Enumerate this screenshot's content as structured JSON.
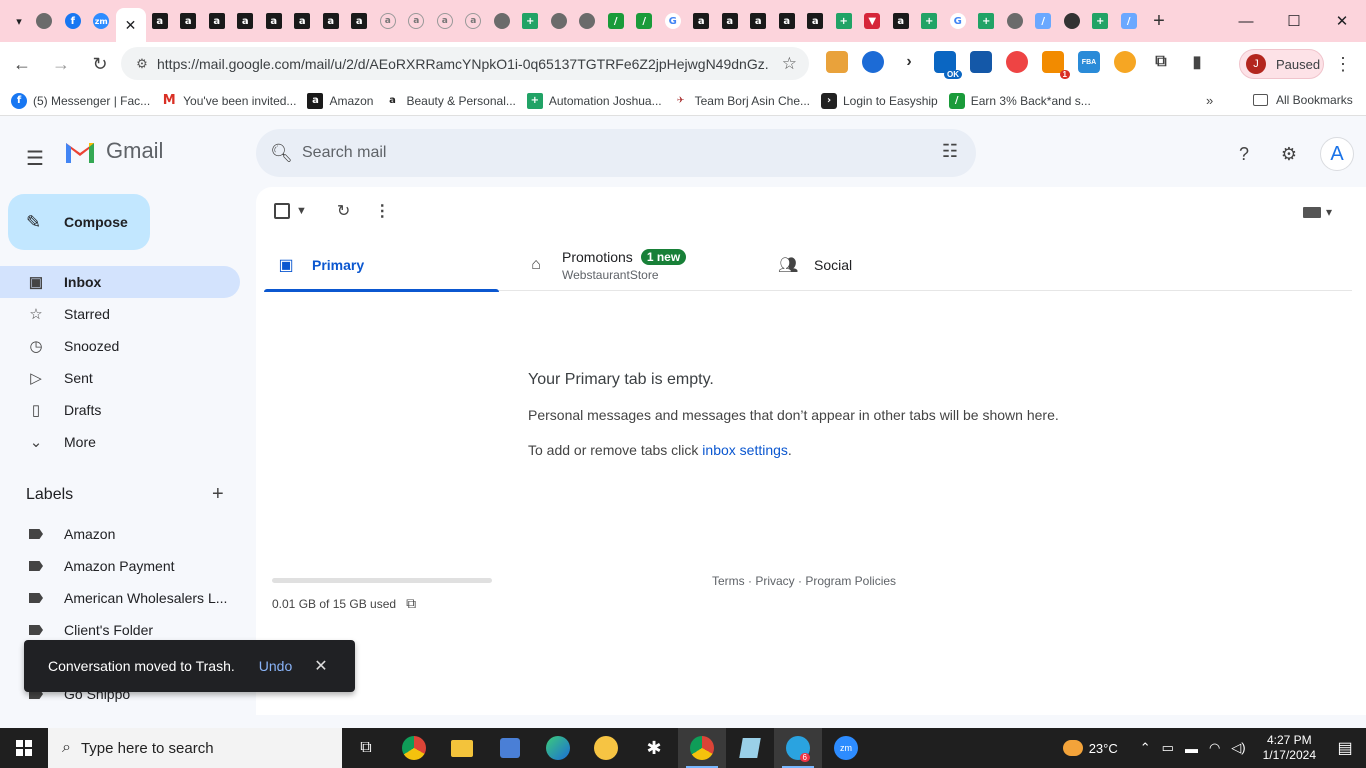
{
  "browser": {
    "url": "https://mail.google.com/mail/u/2/d/AEoRXRRamcYNpkO1i-0q65137TGTRFe6Z2jpHejwgN49dnGz...",
    "profile_initial": "J",
    "profile_status": "Paused",
    "ext_badge_1": "1",
    "ext_ok": "OK",
    "ext_fba": "FBA",
    "bookmarks": [
      {
        "label": "(5) Messenger | Fac..."
      },
      {
        "label": "You've been invited..."
      },
      {
        "label": "Amazon"
      },
      {
        "label": "Beauty & Personal..."
      },
      {
        "label": "Automation Joshua..."
      },
      {
        "label": "Team Borj Asin Che..."
      },
      {
        "label": "Login to Easyship"
      },
      {
        "label": "Earn 3% Back*and s..."
      }
    ],
    "all_bookmarks": "All Bookmarks"
  },
  "gmail": {
    "logo_text": "Gmail",
    "search_placeholder": "Search mail",
    "account_initial": "A",
    "compose_label": "Compose",
    "nav": [
      {
        "label": "Inbox",
        "icon": "inbox-icon"
      },
      {
        "label": "Starred",
        "icon": "star-icon"
      },
      {
        "label": "Snoozed",
        "icon": "clock-icon"
      },
      {
        "label": "Sent",
        "icon": "send-icon"
      },
      {
        "label": "Drafts",
        "icon": "draft-icon"
      },
      {
        "label": "More",
        "icon": "chevron-down-icon"
      }
    ],
    "labels_heading": "Labels",
    "labels": [
      {
        "label": "Amazon"
      },
      {
        "label": "Amazon Payment"
      },
      {
        "label": "American Wholesalers L..."
      },
      {
        "label": "Client's Folder"
      },
      {
        "label": "Go Shippo"
      }
    ],
    "tabs": {
      "primary": "Primary",
      "promotions": "Promotions",
      "promotions_badge": "1 new",
      "promotions_sender": "WebstaurantStore",
      "social": "Social"
    },
    "empty": {
      "title": "Your Primary tab is empty.",
      "line1": "Personal messages and messages that don’t appear in other tabs will be shown here.",
      "line2_prefix": "To add or remove tabs click ",
      "line2_link": "inbox settings",
      "line2_suffix": "."
    },
    "storage": "0.01 GB of 15 GB used",
    "footer": "Terms · Privacy · Program Policies",
    "toast": {
      "message": "Conversation moved to Trash.",
      "undo": "Undo"
    }
  },
  "taskbar": {
    "search_placeholder": "Type here to search",
    "weather": "23°C",
    "time": "4:27 PM",
    "date": "1/17/2024",
    "telegram_badge": "6"
  },
  "colors": {
    "tabstrip": "#fcd4dc",
    "compose": "#c2e7ff",
    "inbox_active": "#d3e3fd",
    "primary_accent": "#0b57d0",
    "new_badge": "#188038"
  }
}
